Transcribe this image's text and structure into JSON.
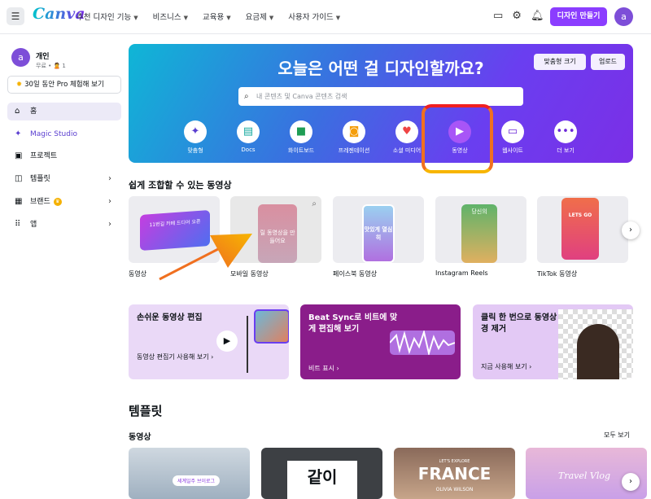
{
  "topbar": {
    "logo": "Canva",
    "menu_icon": "hamburger-icon",
    "nav": [
      "추천 디자인 기능",
      "비즈니스",
      "교육용",
      "요금제",
      "사용자 가이드"
    ],
    "create_label": "디자인 만들기",
    "avatar_letter": "a"
  },
  "sidebar": {
    "user_name": "개인",
    "user_sub": "무료 • 🙎 1",
    "avatar_letter": "a",
    "trial_label": "30일 동안 Pro 체험해 보기",
    "items": [
      {
        "label": "홈",
        "icon": "home-icon"
      },
      {
        "label": "Magic Studio",
        "icon": "sparkle-icon"
      },
      {
        "label": "프로젝트",
        "icon": "folder-icon"
      },
      {
        "label": "템플릿",
        "icon": "template-icon"
      },
      {
        "label": "브랜드",
        "icon": "brand-icon"
      },
      {
        "label": "앱",
        "icon": "apps-icon"
      }
    ]
  },
  "hero": {
    "title": "오늘은 어떤 걸 디자인할까요?",
    "custom_size": "맞춤형 크기",
    "upload": "업로드",
    "search_placeholder": "내 콘텐츠 및 Canva 콘텐츠 검색",
    "categories": [
      {
        "label": "맞춤형",
        "icon": "sparkle-icon",
        "color": "#5a3ed0"
      },
      {
        "label": "Docs",
        "icon": "docs-icon",
        "color": "#13a89e"
      },
      {
        "label": "화이트보드",
        "icon": "whiteboard-icon",
        "color": "#1f9d55"
      },
      {
        "label": "프레젠테이션",
        "icon": "presentation-icon",
        "color": "#f59e0b"
      },
      {
        "label": "소셜 미디어",
        "icon": "heart-icon",
        "color": "#ef4444"
      },
      {
        "label": "동영상",
        "icon": "video-icon",
        "color": "#a855f7"
      },
      {
        "label": "웹사이트",
        "icon": "website-icon",
        "color": "#6d28d9"
      },
      {
        "label": "더 보기",
        "icon": "more-icon",
        "color": "#6d28d9"
      }
    ]
  },
  "video_section": {
    "title": "쉽게 조합할 수 있는 동영상",
    "items": [
      {
        "label": "동영상",
        "overlay": "11번길 카페 드디어 오픈"
      },
      {
        "label": "모바일 동영상",
        "overlay": "릴 동영상을 만들어요"
      },
      {
        "label": "페이스북 동영상",
        "overlay": "맛있게 열심히"
      },
      {
        "label": "Instagram Reels",
        "overlay": "당신의"
      },
      {
        "label": "TikTok 동영상",
        "overlay": "LETS GO"
      }
    ]
  },
  "promos": [
    {
      "title": "손쉬운 동영상 편집",
      "link": "동영상 편집기 사용해 보기 ›"
    },
    {
      "title": "Beat Sync로 비트에 맞게 편집해 보기",
      "link": "비트 표시 ›"
    },
    {
      "title": "클릭 한 번으로 동영상 배경 제거",
      "link": "지금 사용해 보기 ›"
    }
  ],
  "templates": {
    "title": "템플릿",
    "subtitle": "동영상",
    "see_all": "모두 보기",
    "items": [
      {
        "text": "세계일주 브이로그"
      },
      {
        "text": "같이"
      },
      {
        "text": "FRANCE",
        "sub": "LET'S EXPLORE",
        "author": "OLIVIA WILSON"
      },
      {
        "text": "Travel Vlog"
      }
    ]
  }
}
